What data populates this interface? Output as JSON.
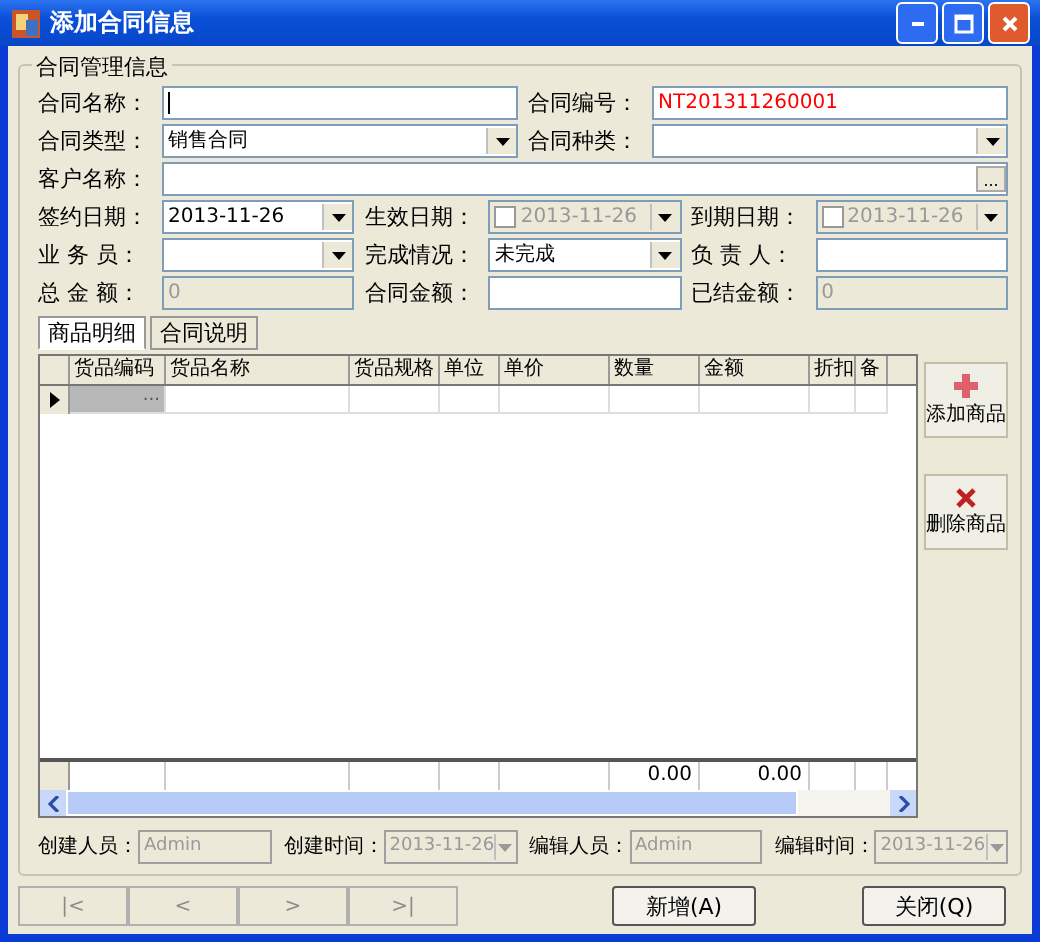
{
  "window": {
    "title": "添加合同信息"
  },
  "group": {
    "title": "合同管理信息"
  },
  "form_rows": [
    [
      {
        "label": "合同名称：",
        "kind": "text",
        "focused": true
      },
      {
        "label": "合同编号：",
        "kind": "text",
        "value": "NT201311260001",
        "color": "#ff0000"
      }
    ],
    [
      {
        "label": "合同类型：",
        "kind": "combo",
        "value": "销售合同"
      },
      {
        "label": "合同种类：",
        "kind": "combo"
      }
    ],
    [
      {
        "label": "客户名称：",
        "kind": "lookup",
        "button": "..."
      }
    ],
    [
      {
        "label": "签约日期：",
        "kind": "date",
        "value": "2013-11-26"
      },
      {
        "label": "生效日期：",
        "kind": "date",
        "value": "2013-11-26",
        "checked": false,
        "disabled": true
      },
      {
        "label": "到期日期：",
        "kind": "date",
        "value": "2013-11-26",
        "checked": false,
        "disabled": true
      }
    ],
    [
      {
        "label": "业 务 员：",
        "kind": "combo"
      },
      {
        "label": "完成情况：",
        "kind": "combo",
        "value": "未完成"
      },
      {
        "label": "负 责 人：",
        "kind": "text"
      }
    ],
    [
      {
        "label": "总 金 额：",
        "kind": "text",
        "value": "0",
        "disabled": true
      },
      {
        "label": "合同金额：",
        "kind": "text"
      },
      {
        "label": "已结金额：",
        "kind": "text",
        "value": "0",
        "disabled": true
      }
    ]
  ],
  "tabs": [
    {
      "label": "商品明细",
      "selected": true
    },
    {
      "label": "合同说明",
      "selected": false
    }
  ],
  "table": {
    "columns": [
      {
        "label": "货品编码"
      },
      {
        "label": "货品名称"
      },
      {
        "label": "货品规格"
      },
      {
        "label": "单位"
      },
      {
        "label": "单价"
      },
      {
        "label": "数量",
        "total": "0.00"
      },
      {
        "label": "金额",
        "total": "0.00"
      },
      {
        "label": "折扣"
      },
      {
        "label": "备"
      }
    ],
    "rows": [
      {
        "selected": true,
        "button": "..."
      }
    ]
  },
  "side_buttons": [
    {
      "label": "添加商品",
      "kind": "add"
    },
    {
      "label": "删除商品",
      "kind": "delete"
    }
  ],
  "audit": [
    {
      "label": "创建人员：",
      "kind": "text",
      "value": "Admin"
    },
    {
      "label": "创建时间：",
      "kind": "date",
      "value": "2013-11-26"
    },
    {
      "label": "编辑人员：",
      "kind": "text",
      "value": "Admin"
    },
    {
      "label": "编辑时间：",
      "kind": "date",
      "value": "2013-11-26"
    }
  ],
  "nav_buttons": [
    {
      "label": "|<",
      "disabled": true
    },
    {
      "label": "<",
      "disabled": true
    },
    {
      "label": ">",
      "disabled": true
    },
    {
      "label": ">|",
      "disabled": true
    }
  ],
  "action_buttons": [
    {
      "label": "新增(A)"
    },
    {
      "label": "关闭(Q)"
    }
  ]
}
